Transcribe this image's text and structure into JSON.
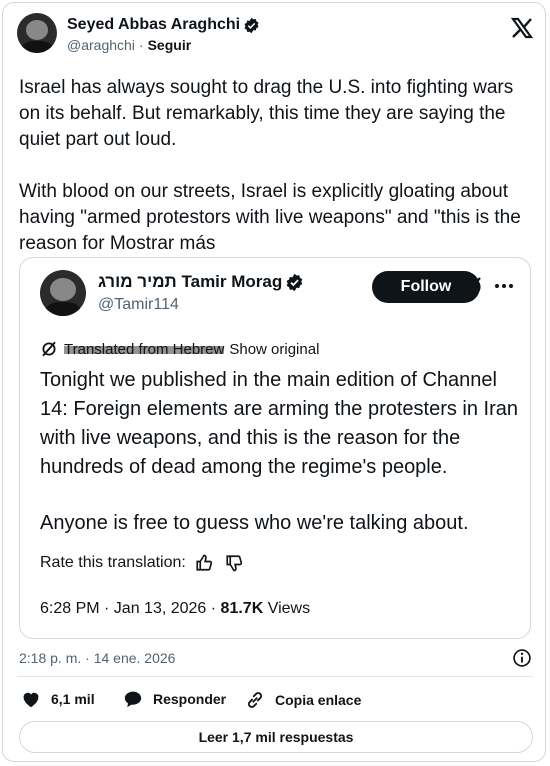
{
  "tweet": {
    "author_name": "Seyed Abbas Araghchi",
    "author_handle": "@araghchi",
    "separator": "·",
    "follow_label": "Seguir",
    "paragraph1": "Israel has always sought to drag the U.S. into fighting wars on its behalf. But remarkably, this time they are saying the quiet part out loud.",
    "paragraph2_prefix": "With blood on our streets, Israel is explicitly gloating about having \"armed protestors with live weapons\" and \"this is the reason for ",
    "show_more": "Mostrar más",
    "timestamp": "2:18 p. m. · 14 ene. 2026",
    "likes": "6,1 mil",
    "reply_label": "Responder",
    "copy_link_label": "Copia enlace",
    "read_replies_label": "Leer 1,7 mil respuestas"
  },
  "quote": {
    "author_name": "תמיר מורג Tamir Morag",
    "author_handle": "@Tamir114",
    "follow_label": "Follow",
    "translated_from": "Translated from Hebrew",
    "show_original": "Show original",
    "text_para1": "Tonight we published in the main edition of Channel 14: Foreign elements are arming the protesters in Iran with live weapons, and this is the reason for the hundreds of dead among the regime's people.",
    "text_para2": "Anyone is free to guess who we're talking about.",
    "rate_label": "Rate this translation:",
    "time_date": "6:28 PM · Jan 13, 2026 · ",
    "views_count": "81.7K",
    "views_label": "Views"
  },
  "icons": {
    "platform": "x-logo-icon",
    "verified": "verified-badge-icon",
    "grok": "slashed-circle-icon",
    "more": "more-icon",
    "info": "info-icon",
    "like": "heart-icon",
    "reply": "speech-bubble-icon",
    "link": "link-icon",
    "thumbs_up": "thumbs-up-icon",
    "thumbs_down": "thumbs-down-icon"
  }
}
